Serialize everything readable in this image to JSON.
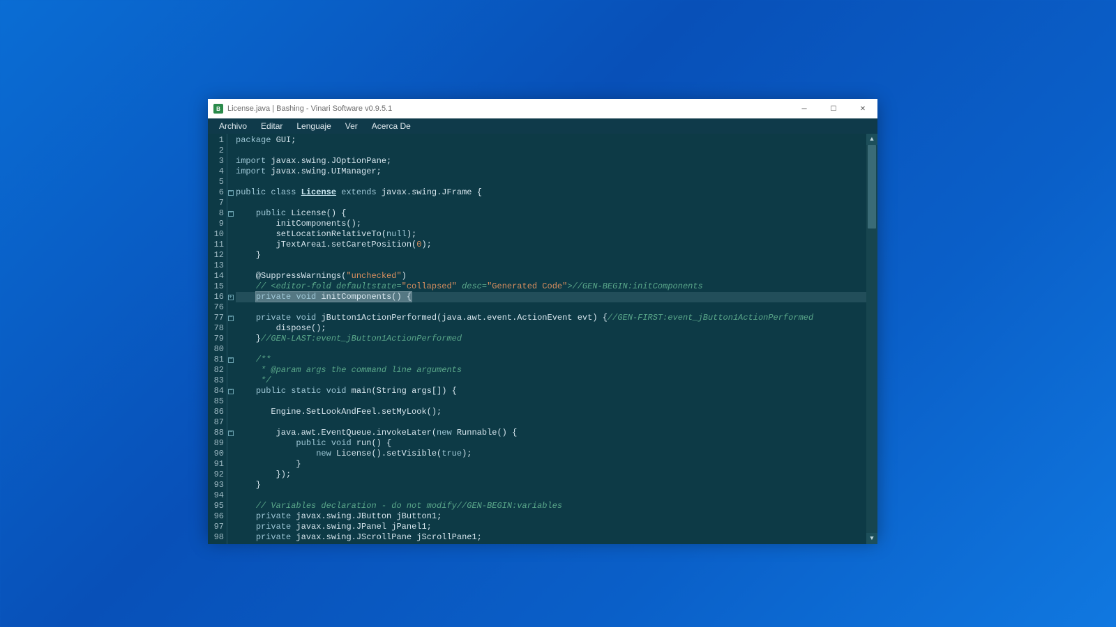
{
  "window": {
    "title": "License.java | Bashing - Vinari Software v0.9.5.1",
    "app_icon_letter": "B"
  },
  "menu": {
    "items": [
      "Archivo",
      "Editar",
      "Lenguaje",
      "Ver",
      "Acerca De"
    ]
  },
  "editor": {
    "highlighted_line_index": 15,
    "lines": [
      {
        "n": 1,
        "fold": "",
        "html": "<span class='kw'>package</span> GUI;"
      },
      {
        "n": 2,
        "fold": "",
        "html": ""
      },
      {
        "n": 3,
        "fold": "",
        "html": "<span class='kw'>import</span> javax.swing.JOptionPane;"
      },
      {
        "n": 4,
        "fold": "",
        "html": "<span class='kw'>import</span> javax.swing.UIManager;"
      },
      {
        "n": 5,
        "fold": "",
        "html": ""
      },
      {
        "n": 6,
        "fold": "open",
        "html": "<span class='kw'>public</span> <span class='kw'>class</span> <span class='cls'>License</span> <span class='kw'>extends</span> javax.swing.JFrame {"
      },
      {
        "n": 7,
        "fold": "",
        "html": ""
      },
      {
        "n": 8,
        "fold": "open",
        "html": "    <span class='kw'>public</span> License() {"
      },
      {
        "n": 9,
        "fold": "",
        "html": "        initComponents();"
      },
      {
        "n": 10,
        "fold": "",
        "html": "        setLocationRelativeTo(<span class='kw'>null</span>);"
      },
      {
        "n": 11,
        "fold": "",
        "html": "        jTextArea1.setCaretPosition(<span class='num'>0</span>);"
      },
      {
        "n": 12,
        "fold": "",
        "html": "    }"
      },
      {
        "n": 13,
        "fold": "",
        "html": ""
      },
      {
        "n": 14,
        "fold": "",
        "html": "    @SuppressWarnings(<span class='str'>\"unchecked\"</span>)"
      },
      {
        "n": 15,
        "fold": "",
        "html": "    <span class='cmt'>// &lt;editor-fold defaultstate=</span><span class='str'>\"collapsed\"</span> <span class='cmt'>desc=</span><span class='str'>\"Generated Code\"</span><span class='cmt'>&gt;//GEN-BEGIN:initComponents</span>"
      },
      {
        "n": 16,
        "fold": "closed",
        "html": "    <span class='sel'><span class='kw'>private</span> <span class='kw'>void</span> initComponents() {</span>"
      },
      {
        "n": 76,
        "fold": "",
        "html": ""
      },
      {
        "n": 77,
        "fold": "open",
        "html": "    <span class='kw'>private</span> <span class='kw'>void</span> jButton1ActionPerformed(java.awt.event.ActionEvent evt) {<span class='cmt'>//GEN-FIRST:event_jButton1ActionPerformed</span>"
      },
      {
        "n": 78,
        "fold": "",
        "html": "        dispose();"
      },
      {
        "n": 79,
        "fold": "",
        "html": "    }<span class='cmt'>//GEN-LAST:event_jButton1ActionPerformed</span>"
      },
      {
        "n": 80,
        "fold": "",
        "html": ""
      },
      {
        "n": 81,
        "fold": "open",
        "html": "    <span class='cmt'>/**</span>"
      },
      {
        "n": 82,
        "fold": "",
        "html": "     <span class='cmt'>* @param args the command line arguments</span>"
      },
      {
        "n": 83,
        "fold": "",
        "html": "     <span class='cmt'>*/</span>"
      },
      {
        "n": 84,
        "fold": "open",
        "html": "    <span class='kw'>public</span> <span class='kw'>static</span> <span class='kw'>void</span> main(String args[]) {"
      },
      {
        "n": 85,
        "fold": "",
        "html": ""
      },
      {
        "n": 86,
        "fold": "",
        "html": "       Engine.SetLookAndFeel.setMyLook();"
      },
      {
        "n": 87,
        "fold": "",
        "html": ""
      },
      {
        "n": 88,
        "fold": "open",
        "html": "        java.awt.EventQueue.invokeLater(<span class='kw'>new</span> Runnable() {"
      },
      {
        "n": 89,
        "fold": "",
        "html": "            <span class='kw'>public</span> <span class='kw'>void</span> run() {"
      },
      {
        "n": 90,
        "fold": "",
        "html": "                <span class='kw'>new</span> License().setVisible(<span class='kw'>true</span>);"
      },
      {
        "n": 91,
        "fold": "",
        "html": "            }"
      },
      {
        "n": 92,
        "fold": "",
        "html": "        });"
      },
      {
        "n": 93,
        "fold": "",
        "html": "    }"
      },
      {
        "n": 94,
        "fold": "",
        "html": ""
      },
      {
        "n": 95,
        "fold": "",
        "html": "    <span class='cmt'>// Variables declaration - do not modify//GEN-BEGIN:variables</span>"
      },
      {
        "n": 96,
        "fold": "",
        "html": "    <span class='kw'>private</span> javax.swing.JButton jButton1;"
      },
      {
        "n": 97,
        "fold": "",
        "html": "    <span class='kw'>private</span> javax.swing.JPanel jPanel1;"
      },
      {
        "n": 98,
        "fold": "",
        "html": "    <span class='kw'>private</span> javax.swing.JScrollPane jScrollPane1;"
      }
    ]
  },
  "colors": {
    "editor_bg": "#0d3a46",
    "menubar_bg": "#0f3a4a",
    "keyword": "#9ec7d6",
    "string": "#d98f5f",
    "comment": "#5aa78a"
  }
}
